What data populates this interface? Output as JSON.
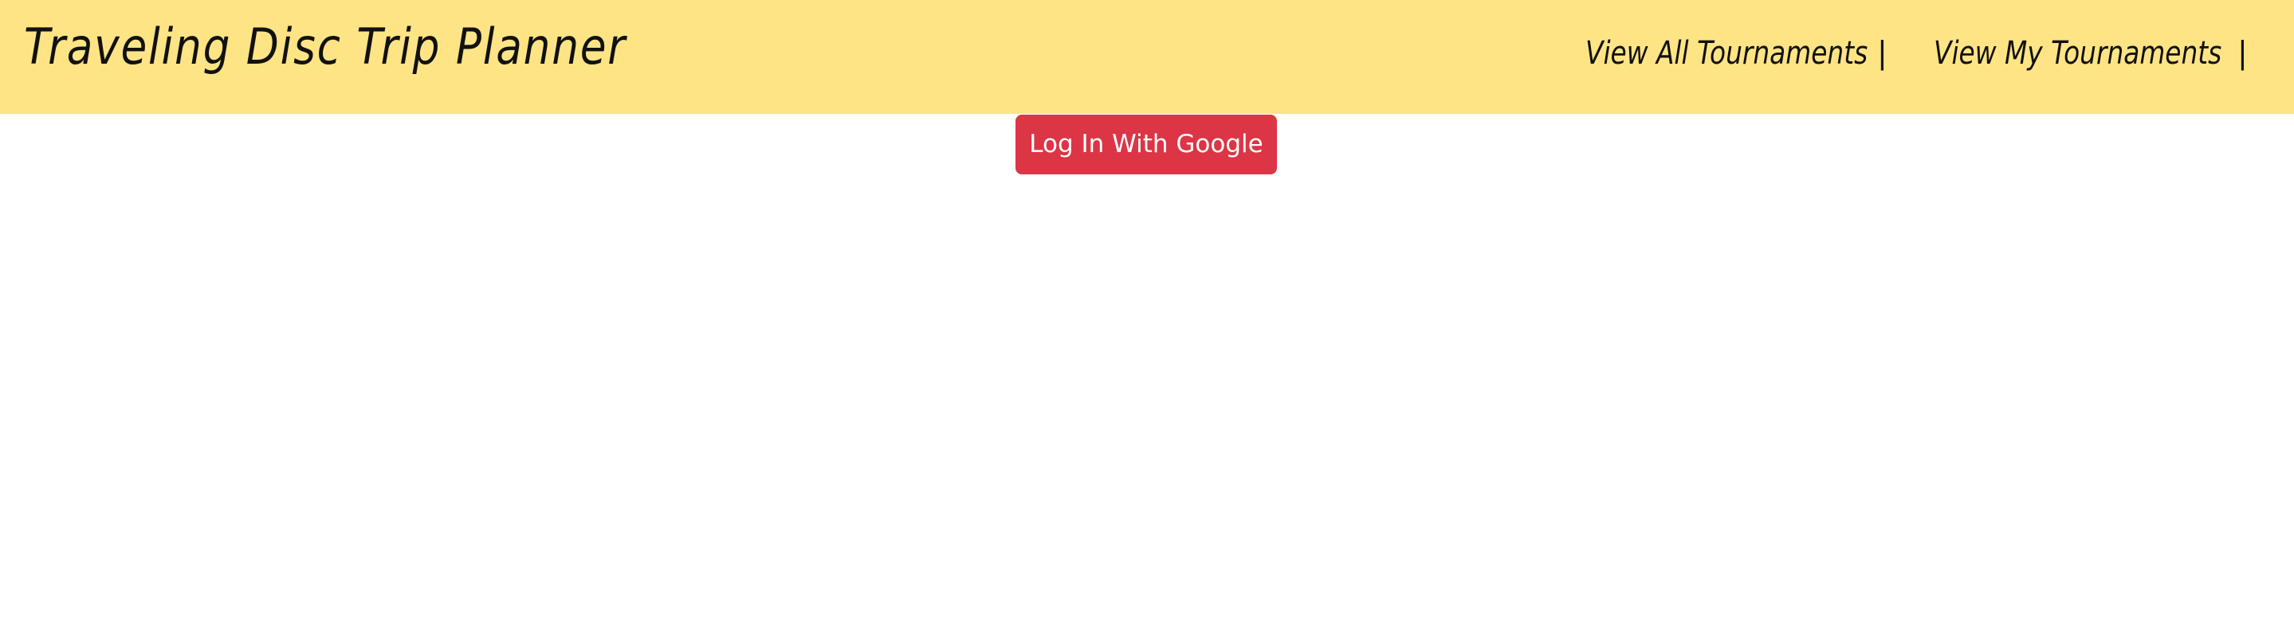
{
  "header": {
    "brand_title": "Traveling Disc Trip Planner",
    "background_color": "#fee485",
    "nav": [
      {
        "label": "View All Tournaments"
      },
      {
        "separator": "|"
      },
      {
        "label": "View My Tournaments"
      },
      {
        "separator": "|"
      }
    ]
  },
  "main": {
    "login_button_label": "Log In With Google",
    "login_button_color": "#dc3545"
  }
}
